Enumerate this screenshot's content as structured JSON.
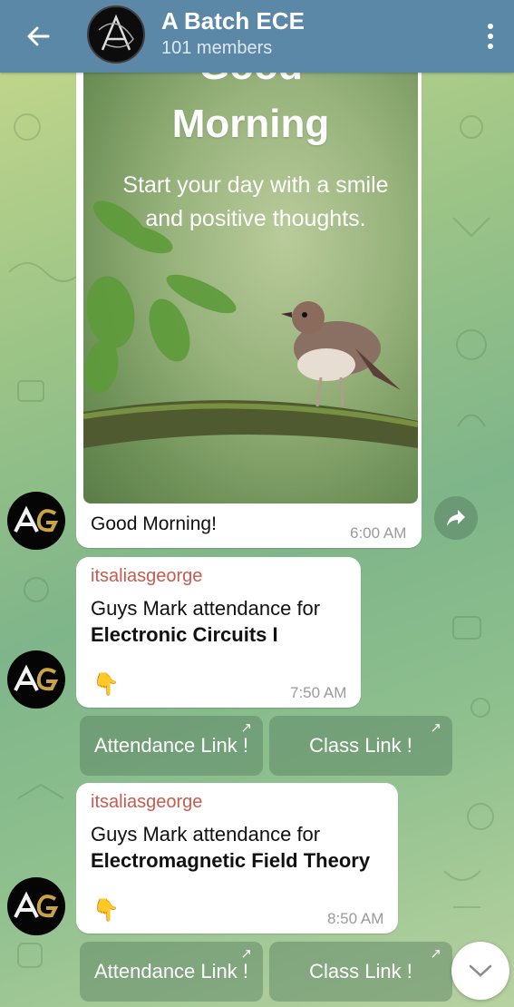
{
  "header": {
    "title": "A Batch ECE",
    "subtitle": "101 members",
    "back_icon": "arrow-left-icon",
    "menu_icon": "more-vertical-icon",
    "color": "#5b88a7"
  },
  "messages": [
    {
      "type": "image",
      "image": {
        "top_text": "Good",
        "title": "Morning",
        "subtitle": "Start your day with a smile and positive thoughts."
      },
      "caption": "Good Morning!",
      "time": "6:00 AM"
    },
    {
      "type": "text",
      "sender": "itsaliasgeorge",
      "text_line1": "Guys Mark attendance for",
      "text_line2_bold": "Electronic Circuits I",
      "emoji": "👇",
      "time": "7:50 AM",
      "buttons": [
        "Attendance Link !",
        "Class Link !"
      ]
    },
    {
      "type": "text",
      "sender": "itsaliasgeorge",
      "text_line1": "Guys Mark attendance for",
      "text_line2_bold": "Electromagnetic Field Theory",
      "emoji": "👇",
      "time": "8:50 AM",
      "buttons": [
        "Attendance Link !",
        "Class Link !"
      ]
    }
  ],
  "button_arrow": "↗",
  "sender_color": "#c65b4f"
}
